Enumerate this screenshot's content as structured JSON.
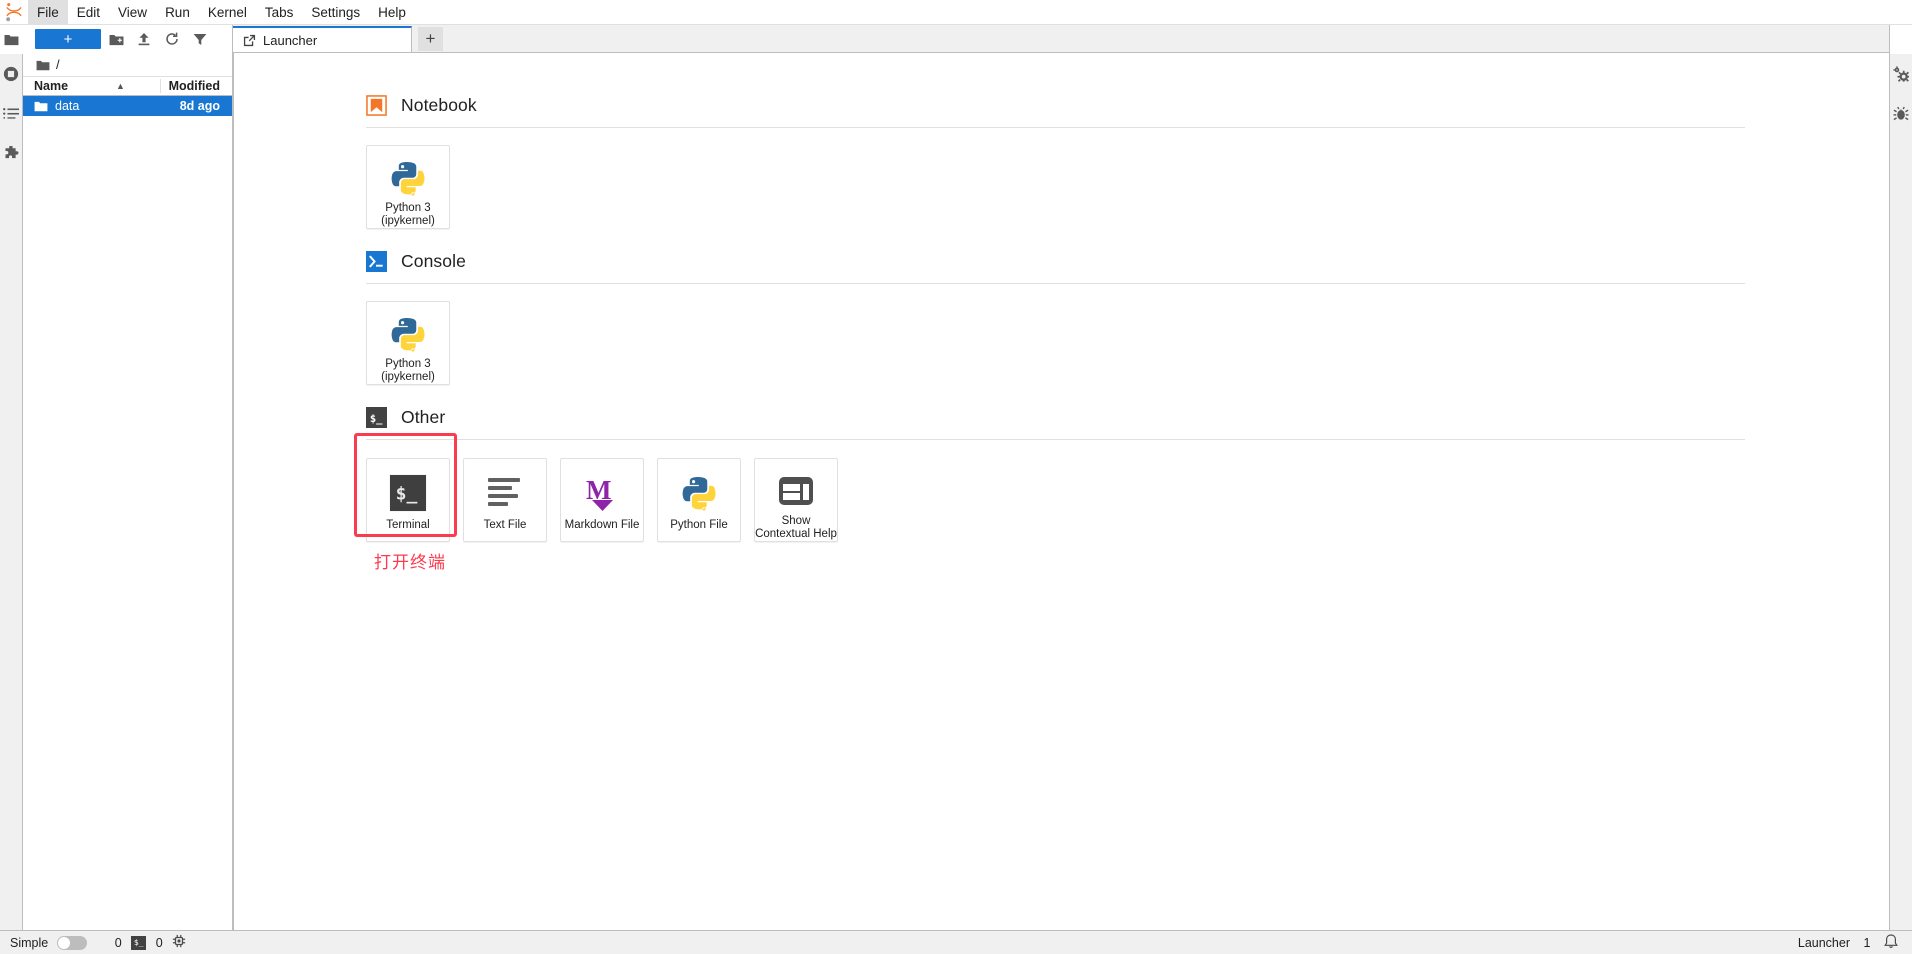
{
  "app": {
    "logo_icon": "jupyter-logo-icon"
  },
  "menubar": {
    "items": [
      {
        "label": "File",
        "active": true
      },
      {
        "label": "Edit",
        "active": false
      },
      {
        "label": "View",
        "active": false
      },
      {
        "label": "Run",
        "active": false
      },
      {
        "label": "Kernel",
        "active": false
      },
      {
        "label": "Tabs",
        "active": false
      },
      {
        "label": "Settings",
        "active": false
      },
      {
        "label": "Help",
        "active": false
      }
    ]
  },
  "left_activitybar": {
    "items": [
      {
        "icon": "folder-icon",
        "name": "file-browser"
      },
      {
        "icon": "running-kernels-icon",
        "name": "running-terminals-and-kernels"
      },
      {
        "icon": "table-of-contents-icon",
        "name": "table-of-contents"
      },
      {
        "icon": "extension-manager-icon",
        "name": "extension-manager"
      }
    ]
  },
  "right_activitybar": {
    "items": [
      {
        "icon": "property-inspector-icon",
        "name": "property-inspector"
      },
      {
        "icon": "debugger-bug-icon",
        "name": "debugger"
      }
    ]
  },
  "filebrowser": {
    "toolbar": {
      "new_launcher_label": "+",
      "new_folder_icon": "new-folder-icon",
      "upload_icon": "upload-icon",
      "refresh_icon": "refresh-icon",
      "filter_icon": "filter-icon"
    },
    "breadcrumb": {
      "home_icon": "folder-icon",
      "path": "/"
    },
    "columns": [
      {
        "label": "Name",
        "sort": "ascending"
      },
      {
        "label": "Modified"
      }
    ],
    "rows": [
      {
        "icon": "folder-icon",
        "name": "data",
        "modified": "8d ago",
        "selected": true
      }
    ]
  },
  "tabbar": {
    "tabs": [
      {
        "label": "Launcher",
        "icon": "launcher-icon",
        "active": true
      }
    ],
    "add_button_label": "+"
  },
  "launcher": {
    "sections": [
      {
        "id": "notebook",
        "title": "Notebook",
        "icon": "notebook-bookmark-icon",
        "icon_color": "#f37726",
        "cards": [
          {
            "label": "Python 3\n(ipykernel)",
            "line1": "Python 3",
            "line2": "(ipykernel)",
            "icon": "python-logo-icon"
          }
        ]
      },
      {
        "id": "console",
        "title": "Console",
        "icon": "console-prompt-icon",
        "icon_color": "#1976d2",
        "cards": [
          {
            "label": "Python 3\n(ipykernel)",
            "line1": "Python 3",
            "line2": "(ipykernel)",
            "icon": "python-logo-icon"
          }
        ]
      },
      {
        "id": "other",
        "title": "Other",
        "icon": "terminal-prompt-icon",
        "icon_color": "#424242",
        "cards": [
          {
            "label": "Terminal",
            "line1": "Terminal",
            "line2": "",
            "icon": "terminal-icon",
            "highlighted": true
          },
          {
            "label": "Text File",
            "line1": "Text File",
            "line2": "",
            "icon": "text-file-icon"
          },
          {
            "label": "Markdown File",
            "line1": "Markdown File",
            "line2": "",
            "icon": "markdown-icon"
          },
          {
            "label": "Python File",
            "line1": "Python File",
            "line2": "",
            "icon": "python-logo-icon"
          },
          {
            "label": "Show Contextual Help",
            "line1": "Show",
            "line2": "Contextual Help",
            "icon": "contextual-help-icon"
          }
        ]
      }
    ]
  },
  "annotation": {
    "text": "打开终端",
    "color": "#fb3b4e"
  },
  "statusbar": {
    "simple_label": "Simple",
    "simple_toggle_on": false,
    "kernel_count": "0",
    "terminal_icon": "terminal-badge-icon",
    "terminal_count": "0",
    "cpu_icon": "kernel-status-icon",
    "current_tab": "Launcher",
    "notification_count": "1",
    "bell_icon": "bell-icon"
  }
}
